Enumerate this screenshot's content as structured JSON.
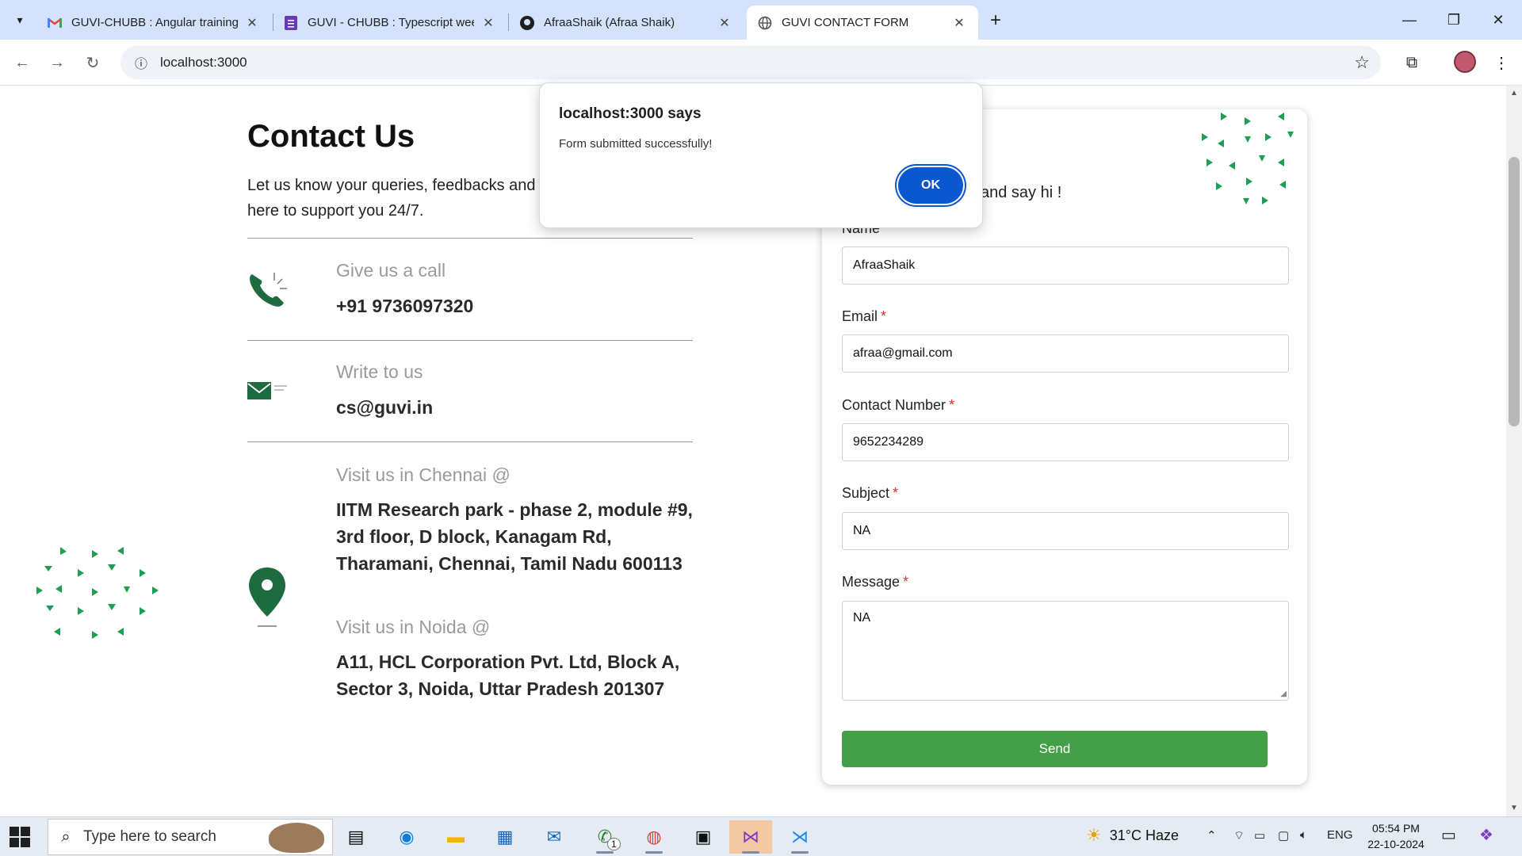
{
  "browser": {
    "tabs": [
      {
        "title": "GUVI-CHUBB : Angular training",
        "icon": "gmail-icon",
        "active": false
      },
      {
        "title": "GUVI - CHUBB : Typescript wee",
        "icon": "forms-icon",
        "active": false
      },
      {
        "title": "AfraaShaik (Afraa Shaik)",
        "icon": "github-icon",
        "active": false
      },
      {
        "title": "GUVI CONTACT FORM",
        "icon": "globe-icon",
        "active": true
      }
    ],
    "url": "localhost:3000"
  },
  "dialog": {
    "title": "localhost:3000 says",
    "message": "Form submitted successfully!",
    "ok_label": "OK"
  },
  "contact": {
    "heading": "Contact Us",
    "intro": "Let us know your queries, feedbacks and enquiries. We are here to support you 24/7.",
    "call_label": "Give us a call",
    "call_value": "+91 9736097320",
    "write_label": "Write to us",
    "write_value": "cs@guvi.in",
    "chennai_label": "Visit us in Chennai @",
    "chennai_address": "IITM Research park - phase 2, module #9, 3rd floor, D block, Kanagam Rd, Tharamani, Chennai, Tamil Nadu 600113",
    "noida_label": "Visit us in Noida @",
    "noida_address": "A11, HCL Corporation Pvt. Ltd, Block A, Sector 3, Noida, Uttar Pradesh 201307"
  },
  "form": {
    "heading_visible": "!",
    "subtitle_visible": "and say hi !",
    "name_label": "Name",
    "name_value": "AfraaShaik",
    "email_label": "Email",
    "email_value": "afraa@gmail.com",
    "contact_label": "Contact Number",
    "contact_value": "9652234289",
    "subject_label": "Subject",
    "subject_value": "NA",
    "message_label": "Message",
    "message_value": "NA",
    "required_mark": "*",
    "send_label": "Send"
  },
  "taskbar": {
    "search_placeholder": "Type here to search",
    "weather": "31°C  Haze",
    "language": "ENG",
    "time": "05:54 PM",
    "date": "22-10-2024",
    "whatsapp_badge": "1"
  },
  "colors": {
    "accent_green": "#1db954",
    "send_green": "#43a047",
    "dialog_blue": "#0b57d0",
    "tabstrip": "#d3e3fd"
  }
}
